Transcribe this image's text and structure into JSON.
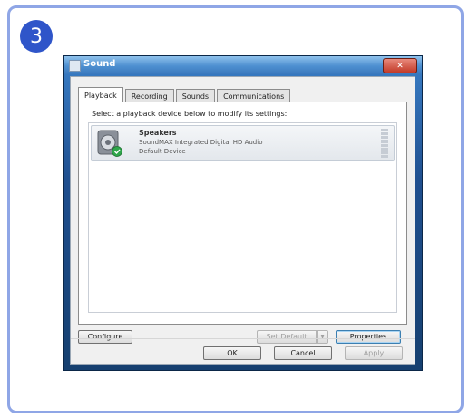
{
  "step": {
    "number": "3"
  },
  "dialog": {
    "title": "Sound",
    "close_glyph": "✕",
    "tabs": [
      {
        "label": "Playback",
        "active": true
      },
      {
        "label": "Recording",
        "active": false
      },
      {
        "label": "Sounds",
        "active": false
      },
      {
        "label": "Communications",
        "active": false
      }
    ],
    "instruction": "Select a playback device below to modify its settings:",
    "device": {
      "name": "Speakers",
      "description": "SoundMAX Integrated Digital HD Audio",
      "status": "Default Device",
      "icon": "speaker-icon",
      "status_icon": "check-icon"
    },
    "buttons": {
      "configure": "Configure",
      "set_default": "Set Default",
      "set_default_arrow": "▼",
      "properties": "Properties",
      "ok": "OK",
      "cancel": "Cancel",
      "apply": "Apply"
    }
  },
  "colors": {
    "frame_border": "#8fa6e6",
    "badge": "#2f55c9",
    "title_bar": "#4d8fd0"
  }
}
